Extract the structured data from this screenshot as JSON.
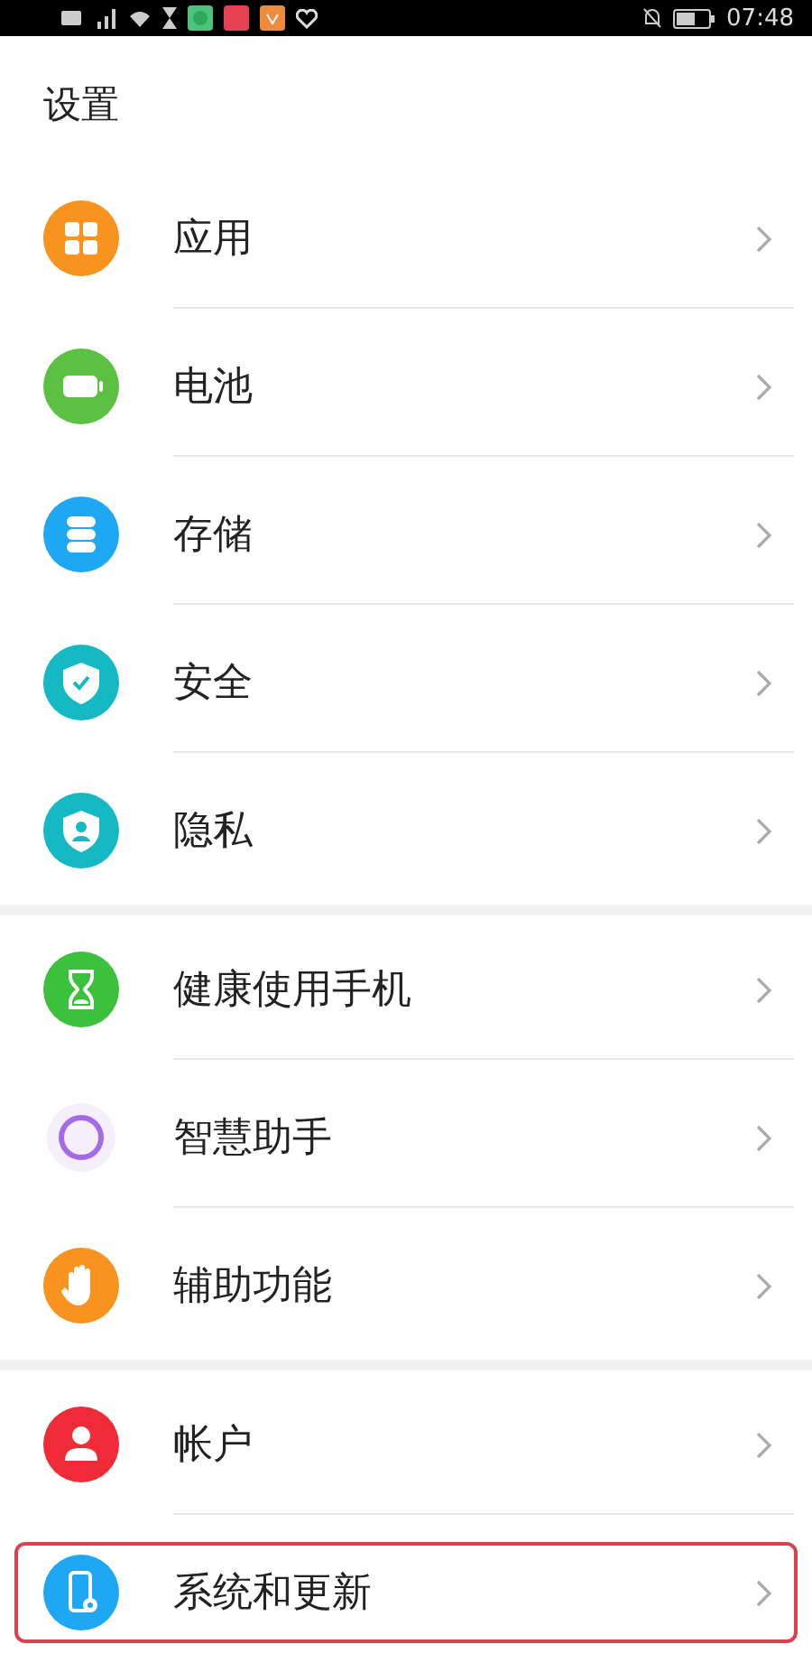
{
  "status_bar": {
    "time": "07:48"
  },
  "title": "设置",
  "groups": [
    {
      "items": [
        {
          "label": "应用",
          "kind": "apps",
          "color": "#f7931e",
          "highlighted": false
        },
        {
          "label": "电池",
          "kind": "battery",
          "color": "#5cc142",
          "highlighted": false
        },
        {
          "label": "存储",
          "kind": "storage",
          "color": "#1ea7f2",
          "highlighted": false
        },
        {
          "label": "安全",
          "kind": "security",
          "color": "#14b9c4",
          "highlighted": false
        },
        {
          "label": "隐私",
          "kind": "privacy",
          "color": "#14b9c4",
          "highlighted": false
        }
      ]
    },
    {
      "items": [
        {
          "label": "健康使用手机",
          "kind": "hourglass",
          "color": "#3cc13c",
          "highlighted": false
        },
        {
          "label": "智慧助手",
          "kind": "assistant",
          "color": "#a46be8",
          "highlighted": false
        },
        {
          "label": "辅助功能",
          "kind": "hand",
          "color": "#f7931e",
          "highlighted": false
        }
      ]
    },
    {
      "items": [
        {
          "label": "帐户",
          "kind": "account",
          "color": "#ee2b37",
          "highlighted": false
        },
        {
          "label": "系统和更新",
          "kind": "system",
          "color": "#1ea7f2",
          "highlighted": true
        }
      ]
    }
  ]
}
